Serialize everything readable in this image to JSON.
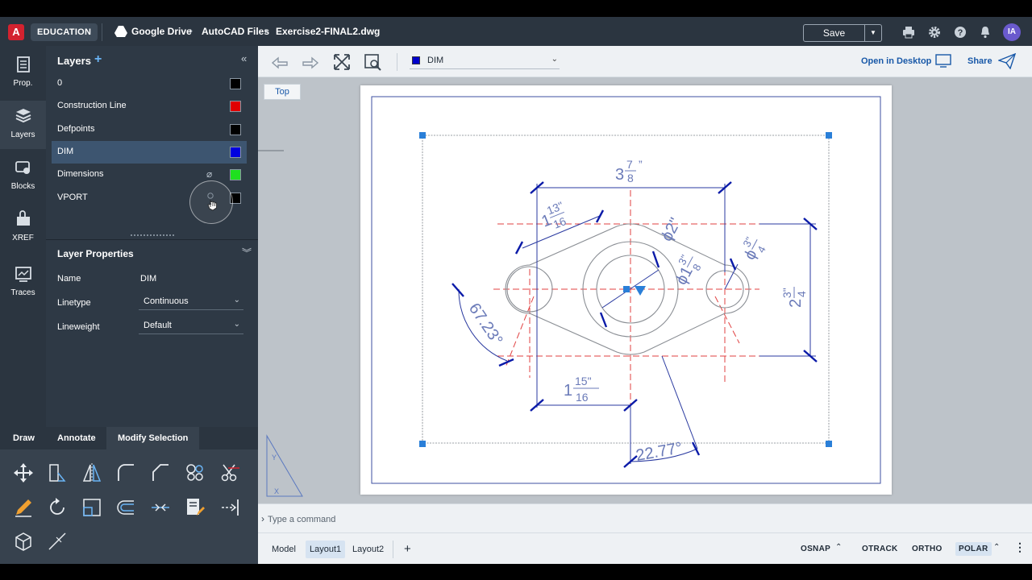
{
  "topbar": {
    "logo_letter": "A",
    "edition": "EDUCATION",
    "breadcrumbs": [
      "Google Drive",
      "AutoCAD Files",
      "Exercise2-FINAL2.dwg"
    ],
    "save_label": "Save",
    "avatar_initials": "IA"
  },
  "rail": [
    {
      "label": "Prop.",
      "icon": "properties-icon"
    },
    {
      "label": "Layers",
      "icon": "layers-icon"
    },
    {
      "label": "Blocks",
      "icon": "blocks-icon"
    },
    {
      "label": "XREF",
      "icon": "xref-icon"
    },
    {
      "label": "Traces",
      "icon": "traces-icon"
    }
  ],
  "layers_panel": {
    "title": "Layers",
    "layers": [
      {
        "name": "0",
        "color": "#000000"
      },
      {
        "name": "Construction Line",
        "color": "#e00000"
      },
      {
        "name": "Defpoints",
        "color": "#000000"
      },
      {
        "name": "DIM",
        "color": "#0000e0"
      },
      {
        "name": "Dimensions",
        "color": "#1fe01f"
      },
      {
        "name": "VPORT",
        "color": "#000000"
      }
    ],
    "selected": "DIM"
  },
  "layer_properties": {
    "title": "Layer Properties",
    "name_label": "Name",
    "name_value": "DIM",
    "linetype_label": "Linetype",
    "linetype_value": "Continuous",
    "lineweight_label": "Lineweight",
    "lineweight_value": "Default"
  },
  "tool_tabs": [
    "Draw",
    "Annotate",
    "Modify Selection"
  ],
  "tool_tabs_active": "Modify Selection",
  "canvas_toolbar": {
    "current_layer": "DIM",
    "open_desktop": "Open in Desktop",
    "share": "Share"
  },
  "view_label": "Top",
  "drawing": {
    "dims": {
      "top_width": "3⅞\"",
      "top_width_whole": "3",
      "top_width_num": "7",
      "top_width_den": "8",
      "diag_left_whole": "1",
      "diag_left_num": "13\"",
      "diag_left_den": "16",
      "dia_center": "ϕ2\"",
      "dia_inner_whole": "ϕ1",
      "dia_inner_num": "3\"",
      "dia_inner_den": "8",
      "dia_right_whole": "ϕ",
      "dia_right_num": "3\"",
      "dia_right_den": "4",
      "height_whole": "2",
      "height_num": "3\"",
      "height_den": "4",
      "bottom_whole": "1",
      "bottom_num": "15\"",
      "bottom_den": "16",
      "angle_left": "67.23°",
      "angle_bottom": "22.77°"
    }
  },
  "command": {
    "placeholder": "Type a command"
  },
  "statusbar": {
    "tabs": [
      "Model",
      "Layout1",
      "Layout2"
    ],
    "active_tab": "Layout1",
    "buttons": [
      "OSNAP",
      "OTRACK",
      "ORTHO",
      "POLAR"
    ],
    "active_button": "POLAR"
  }
}
